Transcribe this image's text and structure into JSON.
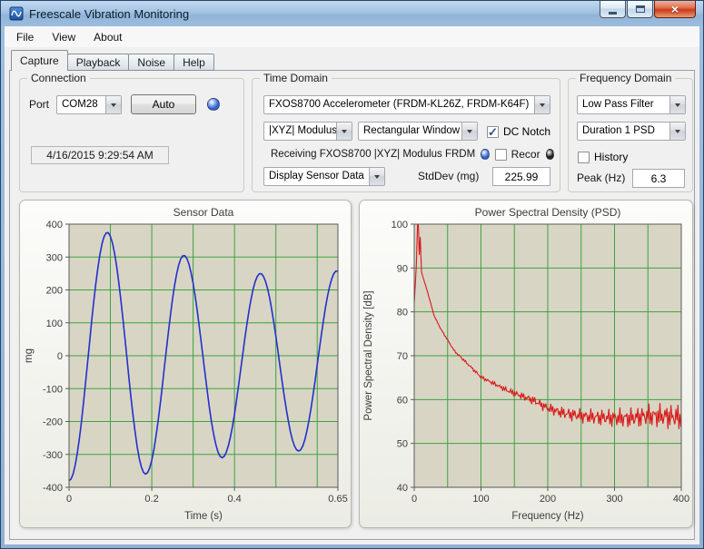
{
  "window": {
    "title": "Freescale Vibration Monitoring"
  },
  "icons": {
    "app": "vibration-waveform-app-icon",
    "minimize": "bar",
    "maximize": "square",
    "close": "×",
    "combo_arrow": "triangle-down",
    "check": "✓",
    "led": "circle"
  },
  "menu": {
    "items": [
      {
        "label": "File"
      },
      {
        "label": "View"
      },
      {
        "label": "About"
      }
    ]
  },
  "tabs": [
    {
      "label": "Capture",
      "active": true
    },
    {
      "label": "Playback",
      "active": false
    },
    {
      "label": "Noise",
      "active": false
    },
    {
      "label": "Help",
      "active": false
    }
  ],
  "connection": {
    "title": "Connection",
    "port_label": "Port",
    "port_value": "COM28",
    "auto_button": "Auto",
    "led_color": "#2F62D8",
    "timestamp": "4/16/2015 9:29:54 AM"
  },
  "time_domain": {
    "title": "Time Domain",
    "sensor_select": "FXOS8700 Accelerometer (FRDM-KL26Z, FRDM-K64F)",
    "mode_select": "|XYZ| Modulus",
    "window_select": "Rectangular Window",
    "dc_notch_label": "DC Notch",
    "dc_notch_checked": true,
    "receiving_text": "Receiving FXOS8700 |XYZ| Modulus FRDM",
    "rx_led_color": "#2F62D8",
    "record_label": "Recor",
    "record_checked": false,
    "record_led_color": "#151515",
    "display_select": "Display Sensor Data",
    "stddev_label": "StdDev (mg)",
    "stddev_value": "225.99"
  },
  "frequency_domain": {
    "title": "Frequency Domain",
    "filter_select": "Low Pass Filter",
    "duration_select": "Duration 1 PSD",
    "history_label": "History",
    "history_checked": false,
    "peak_label": "Peak (Hz)",
    "peak_value": "6.3"
  },
  "chart_style": {
    "plot_bg": "#D8D5C5",
    "grid_color": "#3DA33D",
    "axis_color": "#3c3c3c",
    "title_color": "#3c3c3c"
  },
  "chart_data": [
    {
      "type": "line",
      "name": "sensor",
      "title": "Sensor Data",
      "xlabel": "Time (s)",
      "ylabel": "mg",
      "xlim": [
        0,
        0.65
      ],
      "ylim": [
        -400,
        400
      ],
      "x_ticks": [
        0,
        0.2,
        0.4,
        0.65
      ],
      "y_ticks": [
        -400,
        -300,
        -200,
        -100,
        0,
        100,
        200,
        300,
        400
      ],
      "x_grid_interval": 0.1,
      "grid": true,
      "legend": "none",
      "line_color": "#2330CC",
      "line_width": 1.6,
      "waveform": "damped sine, period ~0.185 s (~5.4 Hz)",
      "extrema_t_mg": [
        [
          0,
          -380
        ],
        [
          0.0925,
          375
        ],
        [
          0.185,
          -360
        ],
        [
          0.2775,
          305
        ],
        [
          0.37,
          -310
        ],
        [
          0.4625,
          250
        ],
        [
          0.555,
          -290
        ],
        [
          0.6475,
          258
        ]
      ],
      "sample_step_s": 0.005
    },
    {
      "type": "line",
      "name": "psd",
      "title": "Power Spectral Density (PSD)",
      "xlabel": "Frequency (Hz)",
      "ylabel": "Power Spectral Density [dB]",
      "xlim": [
        0,
        400
      ],
      "ylim": [
        40,
        100
      ],
      "x_ticks": [
        0,
        100,
        200,
        300,
        400
      ],
      "y_ticks": [
        40,
        50,
        60,
        70,
        80,
        90,
        100
      ],
      "x_grid_interval": 50,
      "grid": true,
      "legend": "none",
      "line_color": "#D91818",
      "line_width": 1.1,
      "peak_hz": 6.3,
      "anchors_hz_db": [
        [
          0,
          82
        ],
        [
          3,
          90
        ],
        [
          5,
          100
        ],
        [
          6.3,
          100
        ],
        [
          7.5,
          93
        ],
        [
          9,
          97
        ],
        [
          11,
          89
        ],
        [
          15,
          87
        ],
        [
          20,
          84.5
        ],
        [
          30,
          79
        ],
        [
          40,
          76
        ],
        [
          50,
          73.5
        ],
        [
          60,
          71
        ],
        [
          70,
          69.5
        ],
        [
          80,
          68
        ],
        [
          90,
          66.5
        ],
        [
          100,
          65
        ],
        [
          120,
          63.5
        ],
        [
          140,
          62
        ],
        [
          160,
          61
        ],
        [
          180,
          60
        ],
        [
          200,
          58.5
        ],
        [
          225,
          57.5
        ],
        [
          250,
          57
        ],
        [
          275,
          56.5
        ],
        [
          300,
          56
        ],
        [
          325,
          55.5
        ],
        [
          350,
          55.5
        ],
        [
          375,
          55
        ],
        [
          400,
          54.5
        ]
      ],
      "noise": {
        "start_hz": 120,
        "max_amplitude_db": 4
      }
    }
  ]
}
